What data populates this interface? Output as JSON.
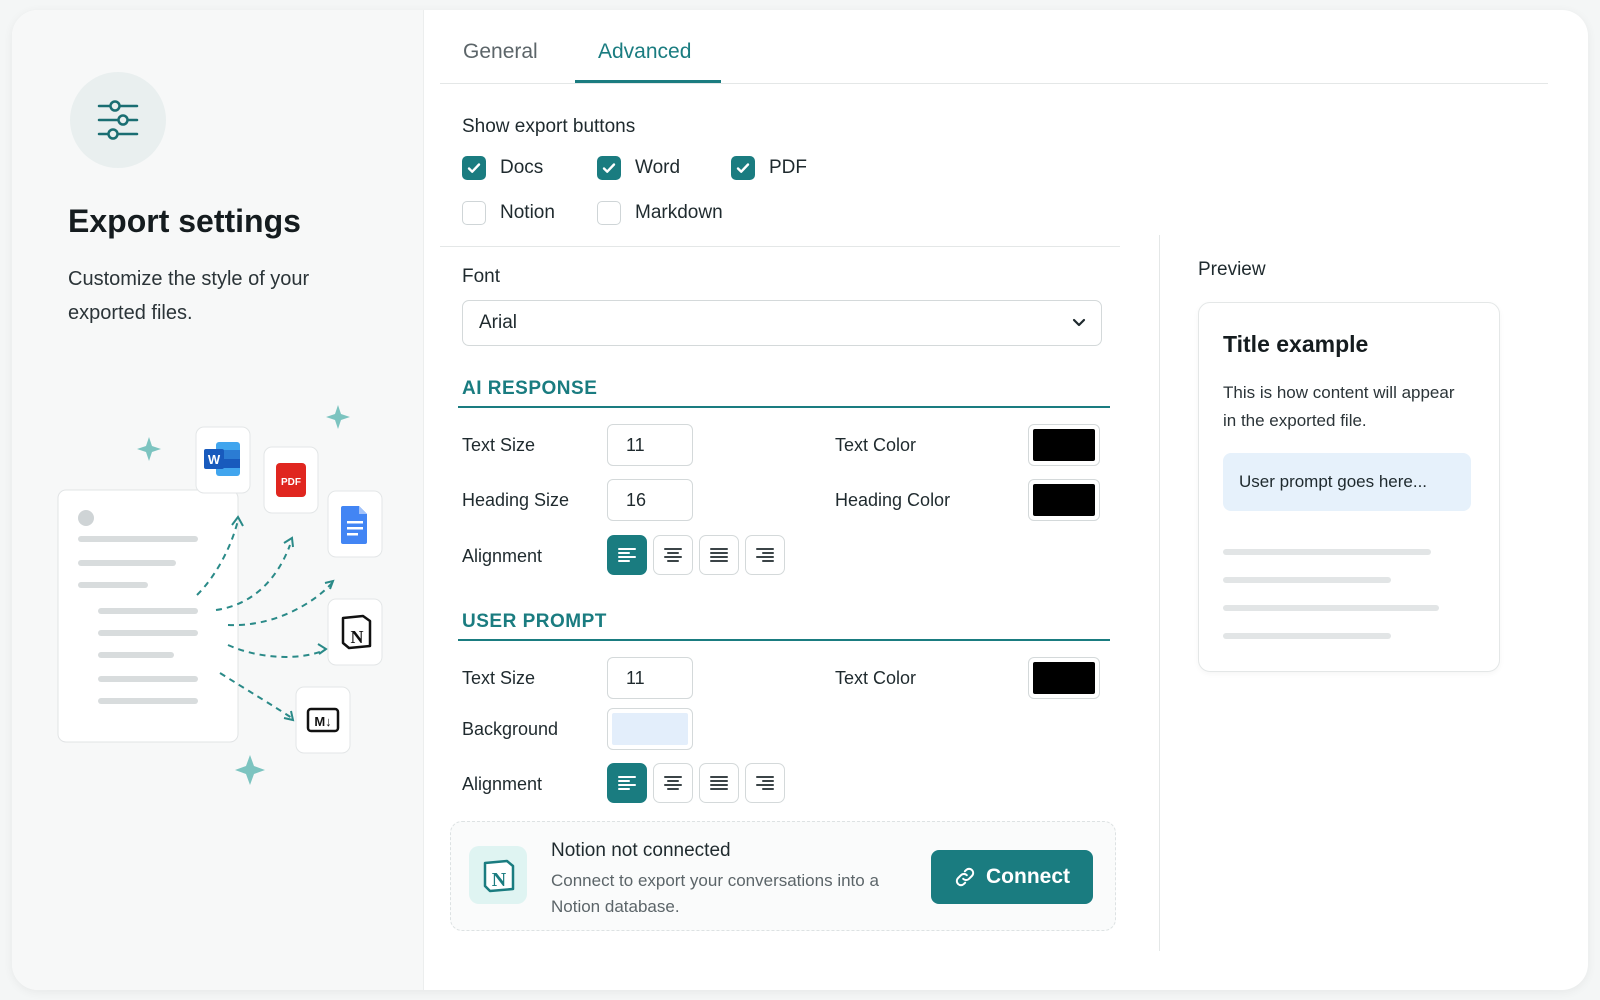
{
  "sidebar": {
    "title": "Export settings",
    "subtitle": "Customize the style of your exported files.",
    "icon": "sliders-icon",
    "illustration_icons": [
      "word-icon",
      "pdf-icon",
      "google-docs-icon",
      "notion-icon",
      "markdown-icon"
    ]
  },
  "tabs": [
    {
      "label": "General",
      "active": false
    },
    {
      "label": "Advanced",
      "active": true
    }
  ],
  "export_buttons": {
    "label": "Show export buttons",
    "options": [
      {
        "label": "Docs",
        "checked": true
      },
      {
        "label": "Word",
        "checked": true
      },
      {
        "label": "PDF",
        "checked": true
      },
      {
        "label": "Notion",
        "checked": false
      },
      {
        "label": "Markdown",
        "checked": false
      }
    ]
  },
  "font": {
    "label": "Font",
    "value": "Arial"
  },
  "ai_response": {
    "heading": "AI RESPONSE",
    "text_size_label": "Text Size",
    "text_size": "11",
    "text_color_label": "Text Color",
    "text_color": "#000000",
    "heading_size_label": "Heading Size",
    "heading_size": "16",
    "heading_color_label": "Heading Color",
    "heading_color": "#000000",
    "alignment_label": "Alignment",
    "alignment": "left"
  },
  "user_prompt": {
    "heading": "USER PROMPT",
    "text_size_label": "Text Size",
    "text_size": "11",
    "text_color_label": "Text Color",
    "text_color": "#000000",
    "background_label": "Background",
    "background": "#e3eefb",
    "alignment_label": "Alignment",
    "alignment": "left"
  },
  "notion": {
    "title": "Notion not connected",
    "description": "Connect to export your conversations into a Notion database.",
    "button": "Connect"
  },
  "preview": {
    "label": "Preview",
    "title": "Title example",
    "body": "This is how content will appear in the exported file.",
    "prompt": "User prompt goes here..."
  },
  "colors": {
    "accent": "#1a7c80",
    "prompt_bg": "#e6f1fb"
  }
}
